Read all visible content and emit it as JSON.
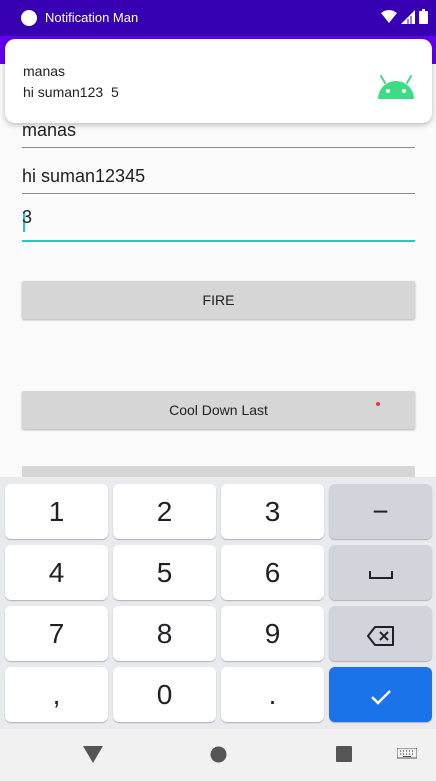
{
  "status_bar": {
    "app_title": "Notification Man"
  },
  "notification": {
    "title": "manas",
    "text": "hi suman123  5",
    "icon": "android-robot-icon"
  },
  "form": {
    "title_value": "manas",
    "message_value": "hi suman12345",
    "number_value": "3"
  },
  "buttons": {
    "fire_label": "FIRE",
    "cooldown_label": "Cool Down Last"
  },
  "keyboard": {
    "rows": [
      [
        "1",
        "2",
        "3",
        "−"
      ],
      [
        "4",
        "5",
        "6",
        "space"
      ],
      [
        "7",
        "8",
        "9",
        "backspace"
      ],
      [
        ",",
        "0",
        ".",
        "done"
      ]
    ],
    "labels": {
      "k1": "1",
      "k2": "2",
      "k3": "3",
      "minus": "−",
      "k4": "4",
      "k5": "5",
      "k6": "6",
      "k7": "7",
      "k8": "8",
      "k9": "9",
      "comma": ",",
      "k0": "0",
      "period": "."
    }
  },
  "colors": {
    "primary": "#6200ee",
    "primary_dark": "#3700b3",
    "accent": "#26c6c6",
    "done_key": "#1a73e8",
    "android_green": "#3ddc84"
  }
}
